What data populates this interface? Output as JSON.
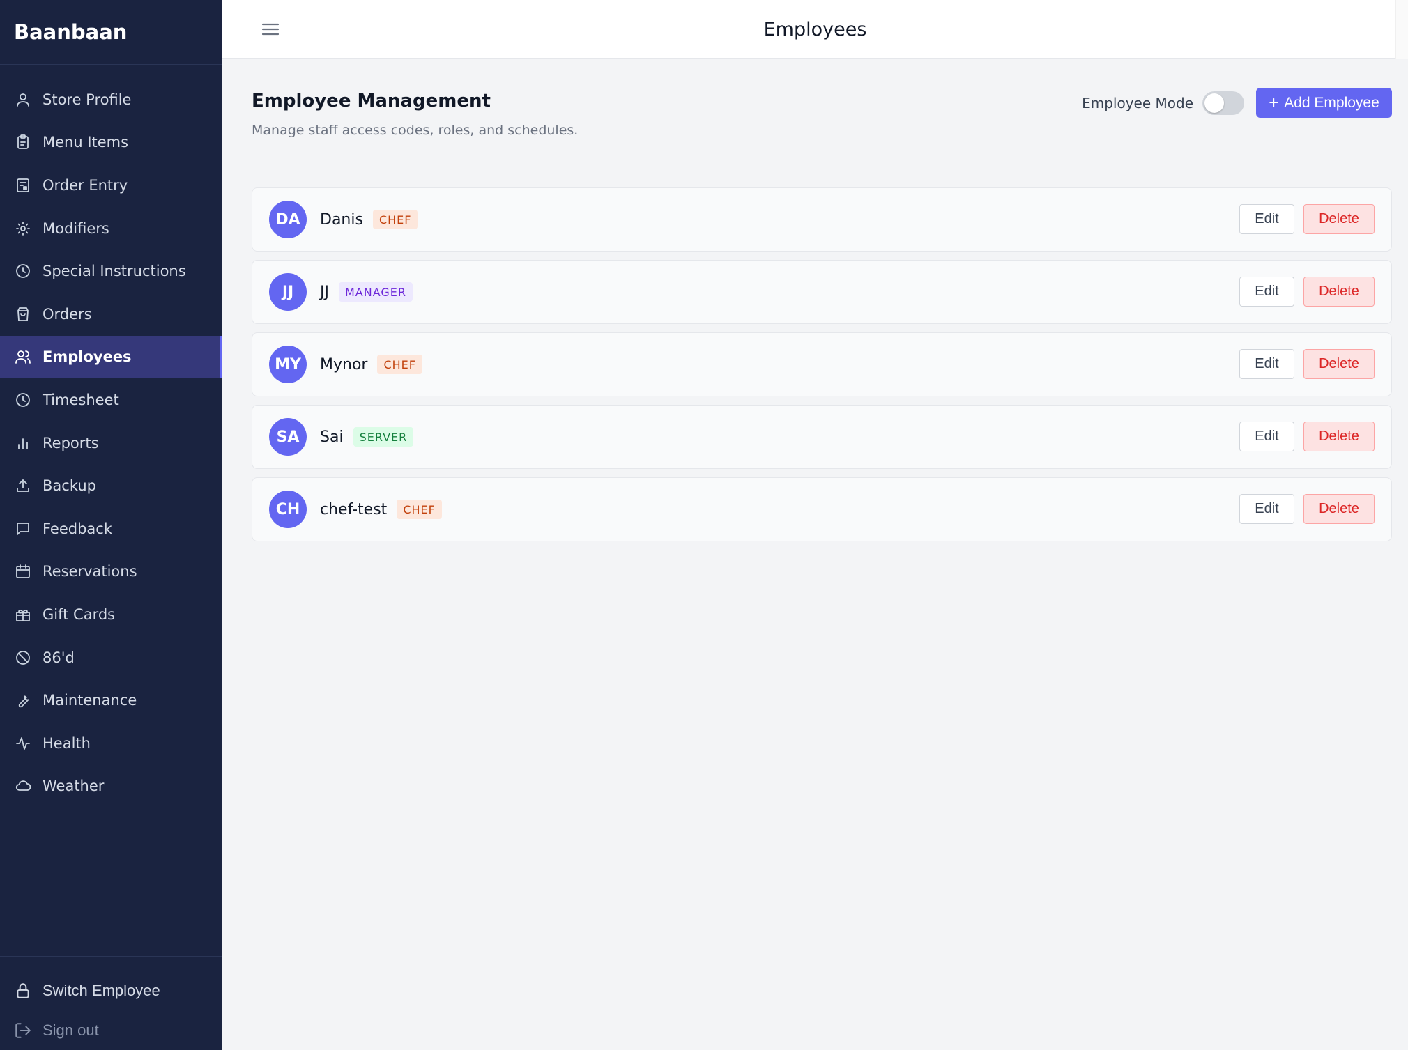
{
  "app": {
    "brand": "Baanbaan"
  },
  "sidebar": {
    "items": [
      {
        "label": "Store Profile",
        "icon": "user-icon",
        "active": false
      },
      {
        "label": "Menu Items",
        "icon": "clipboard-icon",
        "active": false
      },
      {
        "label": "Order Entry",
        "icon": "tablet-icon",
        "active": false
      },
      {
        "label": "Modifiers",
        "icon": "sun-icon",
        "active": false
      },
      {
        "label": "Special Instructions",
        "icon": "clock-icon",
        "active": false
      },
      {
        "label": "Orders",
        "icon": "bag-icon",
        "active": false
      },
      {
        "label": "Employees",
        "icon": "users-icon",
        "active": true
      },
      {
        "label": "Timesheet",
        "icon": "clock-icon",
        "active": false
      },
      {
        "label": "Reports",
        "icon": "bar-chart-icon",
        "active": false
      },
      {
        "label": "Backup",
        "icon": "upload-icon",
        "active": false
      },
      {
        "label": "Feedback",
        "icon": "message-icon",
        "active": false
      },
      {
        "label": "Reservations",
        "icon": "calendar-icon",
        "active": false
      },
      {
        "label": "Gift Cards",
        "icon": "gift-icon",
        "active": false
      },
      {
        "label": "86'd",
        "icon": "ban-icon",
        "active": false
      },
      {
        "label": "Maintenance",
        "icon": "wrench-icon",
        "active": false
      },
      {
        "label": "Health",
        "icon": "activity-icon",
        "active": false
      },
      {
        "label": "Weather",
        "icon": "cloud-icon",
        "active": false
      }
    ],
    "footer": {
      "switch_label": "Switch Employee",
      "signout_label": "Sign out"
    }
  },
  "header": {
    "title": "Employees"
  },
  "main": {
    "title": "Employee Management",
    "subtitle": "Manage staff access codes, roles, and schedules.",
    "mode_label": "Employee Mode",
    "mode_on": false,
    "add_label": "Add Employee",
    "edit_label": "Edit",
    "delete_label": "Delete"
  },
  "employees": [
    {
      "initials": "DA",
      "name": "Danis",
      "role": "CHEF",
      "role_class": "chef"
    },
    {
      "initials": "JJ",
      "name": "JJ",
      "role": "MANAGER",
      "role_class": "manager"
    },
    {
      "initials": "MY",
      "name": "Mynor",
      "role": "CHEF",
      "role_class": "chef"
    },
    {
      "initials": "SA",
      "name": "Sai",
      "role": "SERVER",
      "role_class": "server"
    },
    {
      "initials": "CH",
      "name": "chef-test",
      "role": "CHEF",
      "role_class": "chef"
    }
  ],
  "colors": {
    "sidebar_bg": "#1a2340",
    "accent": "#6366f1",
    "active_item_bg": "#35387a",
    "danger": "#dc2626"
  }
}
